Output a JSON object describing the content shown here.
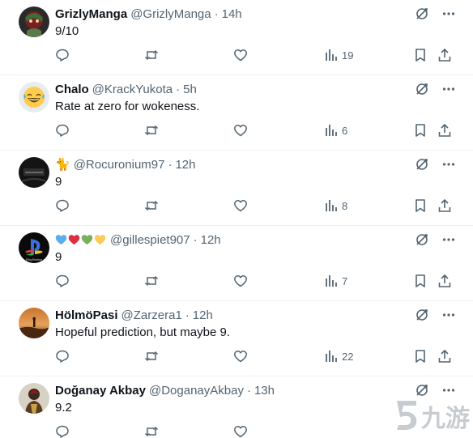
{
  "replies": [
    {
      "name": "GrizlyManga",
      "handle": "@GrizlyManga",
      "time": "14h",
      "text": "9/10",
      "views": "19",
      "avatar_icon": "grizly-avatar"
    },
    {
      "name": "Chalo",
      "handle": "@KrackYukota",
      "time": "5h",
      "text": "Rate at zero for wokeness.",
      "views": "6",
      "avatar_icon": "laughing-emoji-avatar"
    },
    {
      "name": "🐈",
      "handle": "@Rocuronium97",
      "time": "12h",
      "text": "9",
      "views": "8",
      "avatar_icon": "dark-game-cover-avatar"
    },
    {
      "name": "💙❤️💚💛",
      "handle": "@gillespiet907",
      "time": "12h",
      "text": "9",
      "views": "7",
      "avatar_icon": "playstation-logo-avatar"
    },
    {
      "name": "HölmöPasi",
      "handle": "@Zarzera1",
      "time": "12h",
      "text": "Hopeful prediction, but maybe 9.",
      "views": "22",
      "avatar_icon": "desert-sunset-avatar"
    },
    {
      "name": "Doğanay Akbay",
      "handle": "@DoganayAkbay",
      "time": "13h",
      "text": "9.2",
      "views": "",
      "avatar_icon": "character-avatar"
    }
  ],
  "separator": "·",
  "watermark_text": "九游",
  "colors": {
    "text": "#0f1419",
    "secondary": "#536471",
    "divider": "#eff3f4",
    "heart_blue": "#5dadec",
    "heart_red": "#dd2e44",
    "heart_green": "#78b159",
    "heart_yellow": "#fdcb58"
  }
}
